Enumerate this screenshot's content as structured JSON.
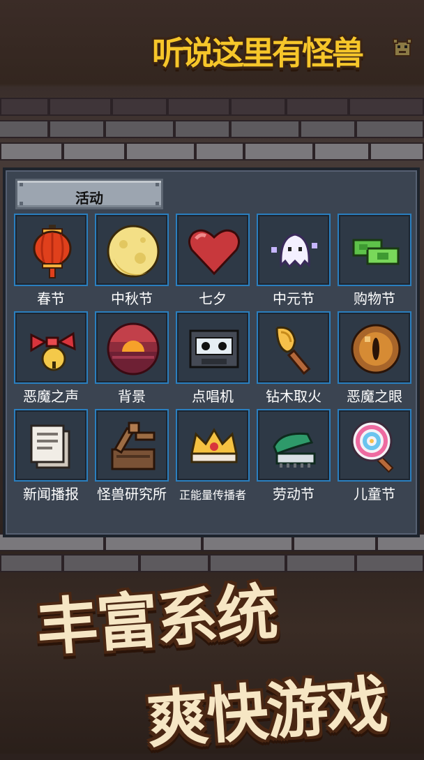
{
  "logo": {
    "title": "听说这里有怪兽"
  },
  "panel": {
    "tab_label": "活动",
    "items": [
      {
        "label": "春节",
        "icon": "lantern-icon"
      },
      {
        "label": "中秋节",
        "icon": "moon-icon"
      },
      {
        "label": "七夕",
        "icon": "heart-icon"
      },
      {
        "label": "中元节",
        "icon": "ghost-icon"
      },
      {
        "label": "购物节",
        "icon": "money-icon"
      },
      {
        "label": "恶魔之声",
        "icon": "bell-bow-icon"
      },
      {
        "label": "背景",
        "icon": "sunset-icon"
      },
      {
        "label": "点唱机",
        "icon": "cassette-icon"
      },
      {
        "label": "钻木取火",
        "icon": "torch-stick-icon"
      },
      {
        "label": "恶魔之眼",
        "icon": "eye-icon"
      },
      {
        "label": "新闻播报",
        "icon": "newspaper-icon"
      },
      {
        "label": "怪兽研究所",
        "icon": "catapult-icon"
      },
      {
        "label": "正能量传播者",
        "icon": "crown-icon"
      },
      {
        "label": "劳动节",
        "icon": "brush-icon"
      },
      {
        "label": "儿童节",
        "icon": "lollipop-icon"
      }
    ]
  },
  "slogans": {
    "line1": "丰富系统",
    "line2": "爽快游戏"
  },
  "colors": {
    "slot_border": "#2a7fbf",
    "panel_bg": "#3b4451",
    "logo_yellow": "#f6c62a",
    "slogan_fill": "#f6e6c4"
  }
}
